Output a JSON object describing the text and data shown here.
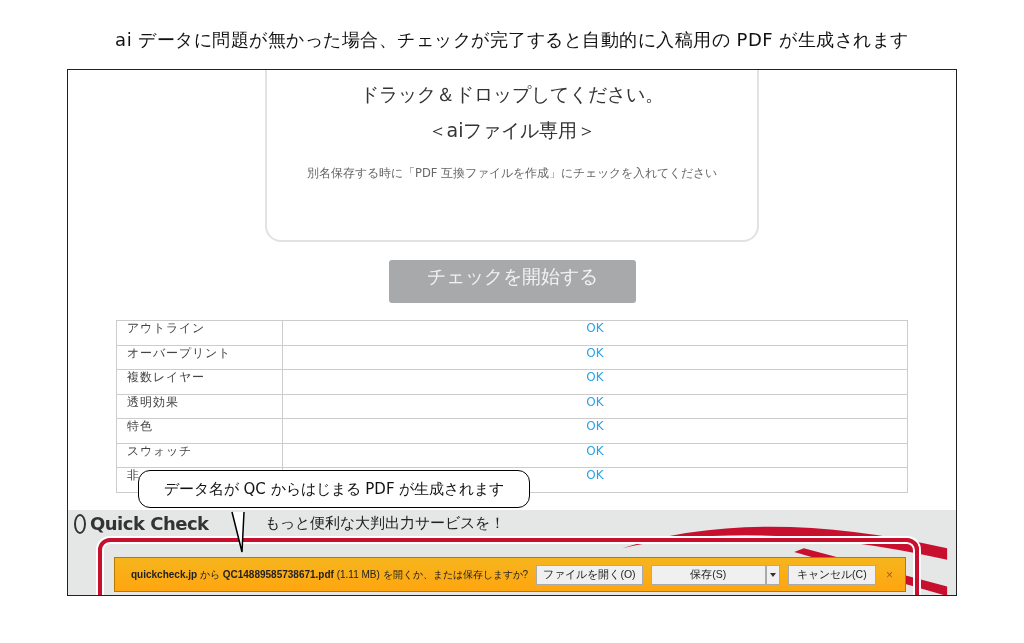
{
  "caption": "ai データに問題が無かった場合、チェックが完了すると自動的に入稿用の PDF が生成されます",
  "drop_zone": {
    "title": "ドラック＆ドロップしてください。",
    "subtitle": "＜aiファイル専用＞",
    "note": "別名保存する時に「PDF 互換ファイルを作成」にチェックを入れてください"
  },
  "start_button": {
    "label": "チェックを開始する",
    "disabled": true
  },
  "checks": [
    {
      "item": "アウトライン",
      "result": "OK"
    },
    {
      "item": "オーバープリント",
      "result": "OK"
    },
    {
      "item": "複数レイヤー",
      "result": "OK"
    },
    {
      "item": "透明効果",
      "result": "OK"
    },
    {
      "item": "特色",
      "result": "OK"
    },
    {
      "item": "スウォッチ",
      "result": "OK"
    },
    {
      "item": "非",
      "result": "OK"
    }
  ],
  "footer": {
    "logo": "Quick Check",
    "tagline": "もっと便利な大判出力サービスを！"
  },
  "callout": {
    "text": "データ名が QC からはじまる PDF が生成されます"
  },
  "download_bar": {
    "message": "**quickcheck.jp** から **QC14889585738671.pdf** (1.11 MB) を開くか、または保存しますか?",
    "buttons": [
      {
        "label": "ファイルを開く(O)",
        "kind": "plain"
      },
      {
        "label": "保存(S)",
        "kind": "split"
      },
      {
        "label": "キャンセル(C)",
        "kind": "plain"
      }
    ],
    "close": "×"
  }
}
